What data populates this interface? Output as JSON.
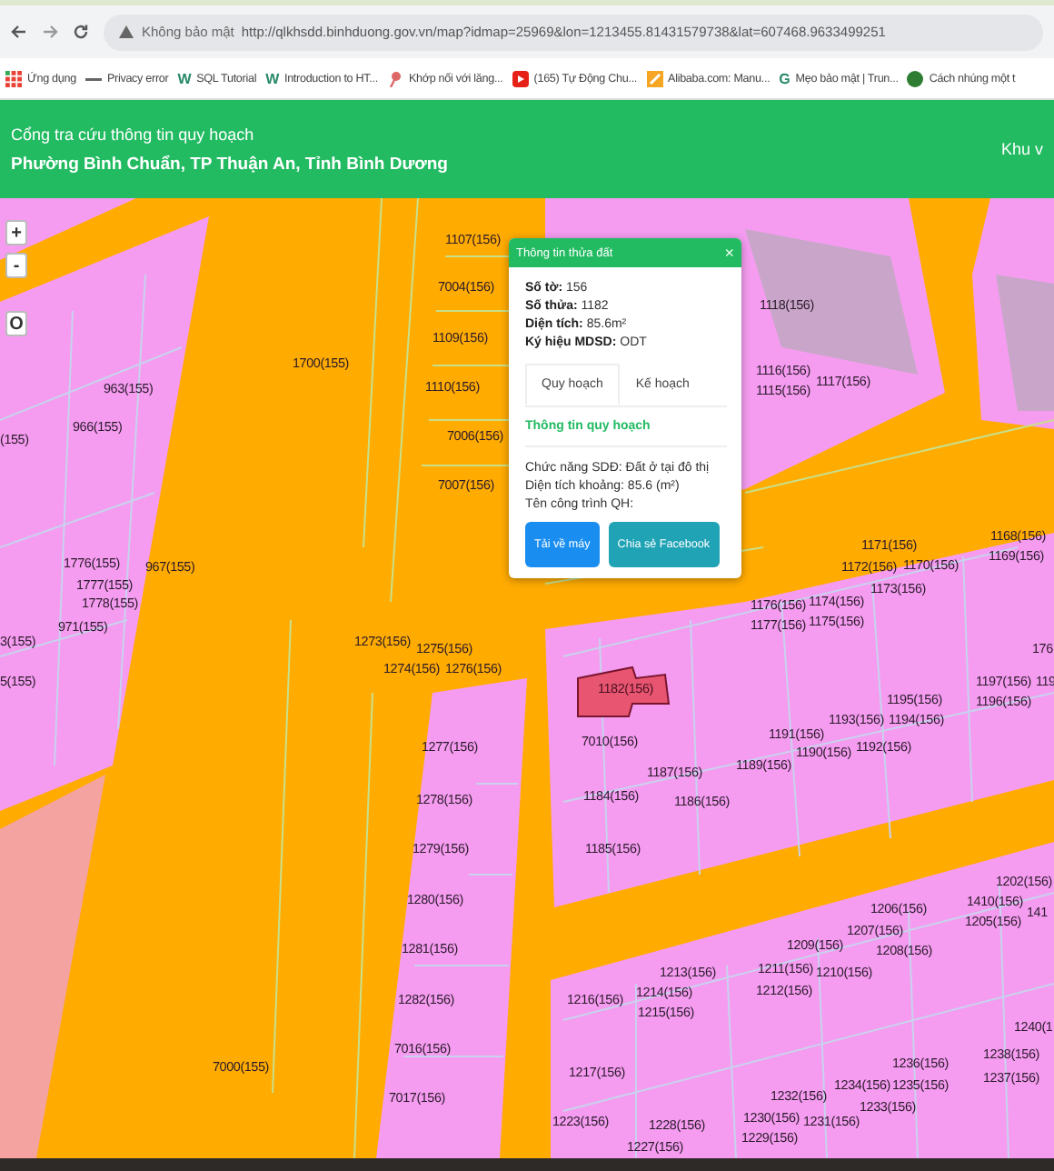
{
  "browser": {
    "address": {
      "security": "Không bảo mật",
      "url": "http://qlkhsdd.binhduong.gov.vn/map?idmap=25969&lon=1213455.81431579738&lat=607468.9633499251"
    },
    "bookmarks": [
      {
        "kind": "apps",
        "label": "Ứng dụng"
      },
      {
        "kind": "dash",
        "label": "Privacy error"
      },
      {
        "kind": "letter",
        "icon_text": "W",
        "label": "SQL Tutorial"
      },
      {
        "kind": "letter",
        "icon_text": "W",
        "label": "Introduction to HT..."
      },
      {
        "kind": "pin",
        "label": "Khớp nối với lăng..."
      },
      {
        "kind": "video",
        "label": "(165) Tự Động Chu..."
      },
      {
        "kind": "shop",
        "label": "Alibaba.com: Manu..."
      },
      {
        "kind": "letter",
        "icon_text": "G",
        "label": "Mẹo bảo mật | Trun..."
      },
      {
        "kind": "circle",
        "label": "Cách nhúng một t"
      }
    ]
  },
  "header": {
    "title": "Cổng tra cứu thông tin quy hoạch",
    "subtitle": "Phường Bình Chuẩn, TP Thuận An, Tỉnh Bình Dương",
    "right_text": "Khu v"
  },
  "map": {
    "zoom_controls": [
      "+",
      "-",
      "O"
    ],
    "selected_parcel": "1182(156)",
    "parcel_labels": [
      "1107(156)",
      "7004(156)",
      "1109(156)",
      "1110(156)",
      "7006(156)",
      "7007(156)",
      "1700(155)",
      "963(155)",
      "966(155)",
      "(155)",
      "1776(155)",
      "1777(155)",
      "1778(155)",
      "967(155)",
      "971(155)",
      "3(155)",
      "5(155)",
      "1273(156)",
      "1275(156)",
      "1274(156)",
      "1276(156)",
      "1118(156)",
      "1116(156)",
      "1115(156)",
      "1117(156)",
      "1171(156)",
      "1172(156)",
      "1170(156)",
      "1173(156)",
      "1176(156)",
      "1177(156)",
      "1174(156)",
      "1175(156)",
      "1168(156)",
      "1169(156)",
      "176",
      "1197(156)",
      "119",
      "1196(156)",
      "1195(156)",
      "1193(156)",
      "1194(156)",
      "1191(156)",
      "1190(156)",
      "1192(156)",
      "1189(156)",
      "7010(156)",
      "1187(156)",
      "1184(156)",
      "1186(156)",
      "1185(156)",
      "1277(156)",
      "1278(156)",
      "1279(156)",
      "1280(156)",
      "1281(156)",
      "1282(156)",
      "7016(156)",
      "7017(156)",
      "7000(155)",
      "1202(156)",
      "1410(156)",
      "141",
      "1205(156)",
      "1206(156)",
      "1207(156)",
      "1208(156)",
      "1209(156)",
      "1211(156)",
      "1210(156)",
      "1212(156)",
      "1213(156)",
      "1214(156)",
      "1215(156)",
      "1216(156)",
      "1240(1",
      "1238(156)",
      "1237(156)",
      "1236(156)",
      "1234(156)",
      "1235(156)",
      "1233(156)",
      "1232(156)",
      "1230(156)",
      "1231(156)",
      "1229(156)",
      "1217(156)",
      "1223(156)",
      "1228(156)",
      "1227(156)"
    ]
  },
  "popup": {
    "title": "Thông tin thửa đất",
    "close": "×",
    "fields": [
      {
        "label": "Số tờ:",
        "value": "156"
      },
      {
        "label": "Số thửa:",
        "value": "1182"
      },
      {
        "label": "Diện tích:",
        "value": "85.6m²"
      },
      {
        "label": "Ký hiệu MDSD:",
        "value": "ODT"
      }
    ],
    "tabs": [
      {
        "label": "Quy hoạch",
        "selected": true
      },
      {
        "label": "Kế hoạch",
        "selected": false
      }
    ],
    "section_title": "Thông tin quy hoạch",
    "details": [
      "Chức năng SDĐ: Đất ở tại đô thị",
      "Diện tích khoảng: 85.6 (m²)",
      "Tên công trình QH:"
    ],
    "buttons": [
      {
        "kind": "primary",
        "label": "Tải về máy"
      },
      {
        "kind": "share",
        "label": "Chia sẻ Facebook"
      }
    ]
  }
}
